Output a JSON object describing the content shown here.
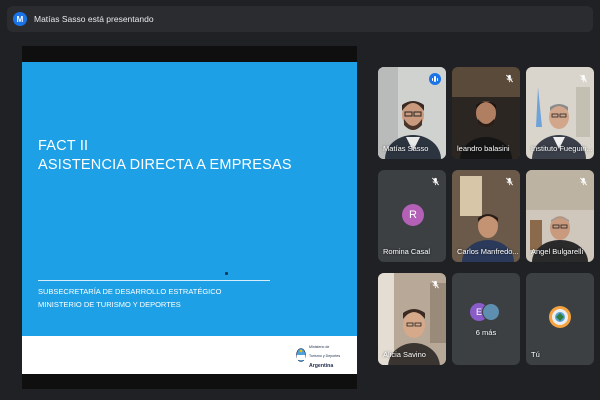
{
  "presenter": {
    "initial": "M",
    "text": "Matías Sasso está presentando"
  },
  "slide": {
    "title_line1": "FACT II",
    "title_line2": "ASISTENCIA DIRECTA A EMPRESAS",
    "sub_line1": "SUBSECRETARÍA DE DESARROLLO ESTRATÉGICO",
    "sub_line2": "MINISTERIO DE TURISMO Y DEPORTES",
    "logo_line1": "Ministerio de",
    "logo_line2": "Turismo y Deportes",
    "logo_line3": "Argentina"
  },
  "participants": [
    {
      "name": "Matías Sasso",
      "speaking": true,
      "type": "video"
    },
    {
      "name": "leandro balasini",
      "muted": true,
      "type": "video"
    },
    {
      "name": "Instituto Fueguin...",
      "muted": true,
      "type": "video"
    },
    {
      "name": "Romina Casal",
      "muted": true,
      "type": "avatar",
      "initial": "R",
      "color": "#b360b6"
    },
    {
      "name": "Carlos Manfredo...",
      "muted": true,
      "type": "video"
    },
    {
      "name": "Angel Bulgarelli",
      "muted": true,
      "type": "video"
    },
    {
      "name": "Alicia Savino",
      "muted": true,
      "type": "video"
    },
    {
      "name": "6 más",
      "type": "more",
      "initial": "E",
      "color": "#8a5cc9"
    },
    {
      "name": "Tú",
      "type": "self"
    }
  ],
  "colors": {
    "background": "#202124",
    "tile": "#3c4043",
    "slide_blue": "#1ea0e6",
    "accent": "#1a73e8"
  }
}
